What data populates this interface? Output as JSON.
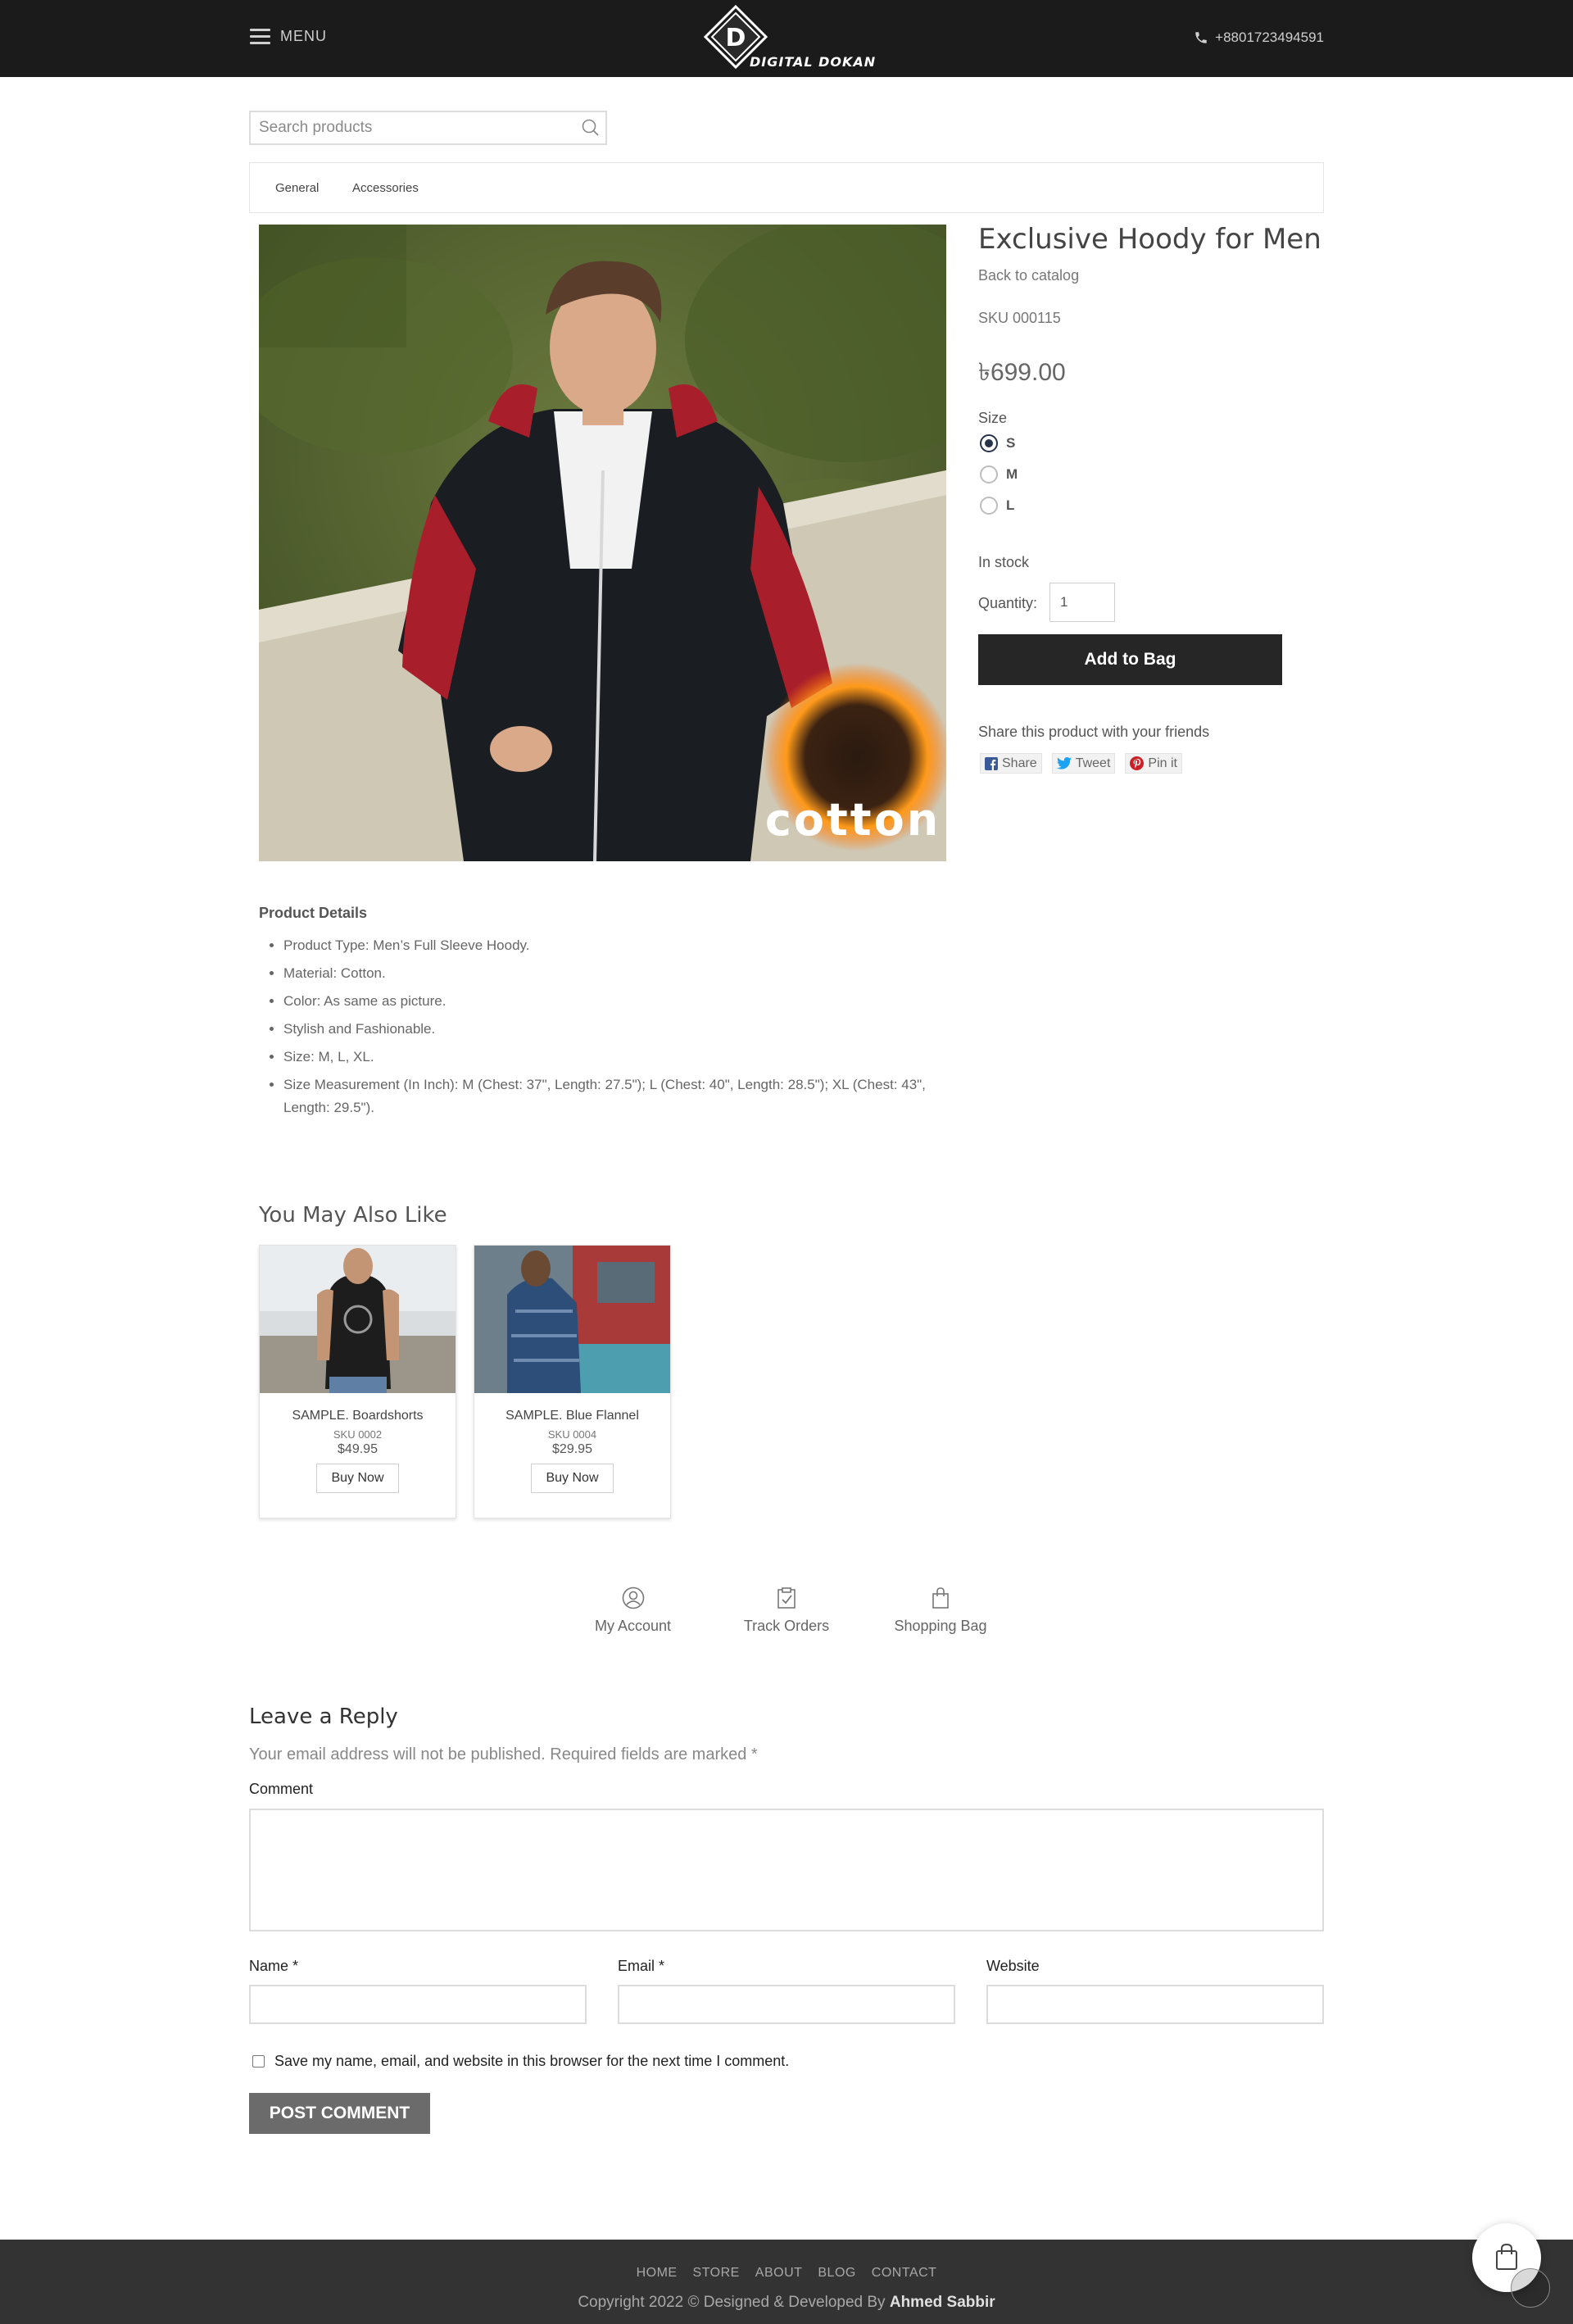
{
  "header": {
    "menu_label": "MENU",
    "logo_letter": "D",
    "logo_text": "DIGITAL DOKAN",
    "phone": "+8801723494591"
  },
  "search": {
    "placeholder": "Search products"
  },
  "categories": [
    "General",
    "Accessories"
  ],
  "product": {
    "title": "Exclusive Hoody for Men",
    "back_link": "Back to catalog",
    "sku": "SKU 000115",
    "price": "৳699.00",
    "size_label": "Size",
    "sizes": [
      "S",
      "M",
      "L"
    ],
    "selected_size": "S",
    "stock": "In stock",
    "quantity_label": "Quantity:",
    "quantity": "1",
    "add_to_bag": "Add to Bag",
    "share_label": "Share this product with your friends",
    "share_buttons": [
      "Share",
      "Tweet",
      "Pin it"
    ],
    "image_badge": "cotton"
  },
  "details": {
    "heading": "Product Details",
    "items": [
      "Product Type: Men’s Full Sleeve Hoody.",
      "Material: Cotton.",
      "Color: As same as picture.",
      "Stylish and Fashionable.",
      "Size: M, L, XL.",
      "Size Measurement (In Inch): M (Chest: 37\", Length: 27.5\"); L (Chest: 40\", Length: 28.5\"); XL (Chest: 43\", Length: 29.5\")."
    ]
  },
  "related": {
    "heading": "You May Also Like",
    "items": [
      {
        "name": "SAMPLE. Boardshorts",
        "sku": "SKU 0002",
        "price": "$49.95",
        "button": "Buy Now"
      },
      {
        "name": "SAMPLE. Blue Flannel",
        "sku": "SKU 0004",
        "price": "$29.95",
        "button": "Buy Now"
      }
    ]
  },
  "account_links": [
    "My Account",
    "Track Orders",
    "Shopping Bag"
  ],
  "reply": {
    "heading": "Leave a Reply",
    "note": "Your email address will not be published. Required fields are marked *",
    "comment_label": "Comment",
    "name_label": "Name *",
    "email_label": "Email *",
    "website_label": "Website",
    "save_text": "Save my name, email, and website in this browser for the next time I comment.",
    "post_button": "POST COMMENT"
  },
  "footer": {
    "nav": [
      "HOME",
      "STORE",
      "ABOUT",
      "BLOG",
      "CONTACT"
    ],
    "copyright": "Copyright 2022 © Designed & Developed By",
    "author": "Ahmed Sabbir"
  }
}
